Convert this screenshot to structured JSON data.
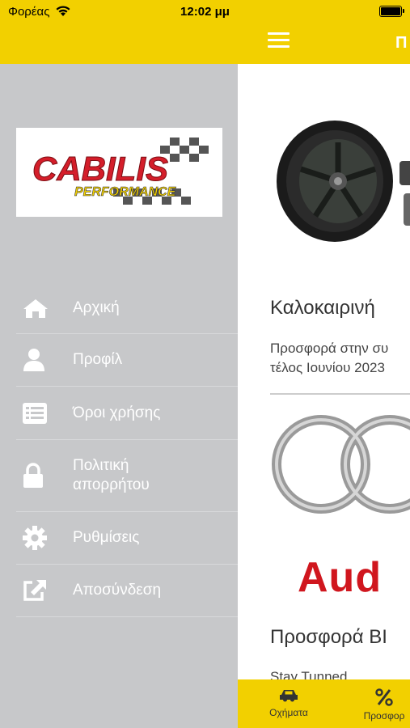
{
  "status_bar": {
    "carrier": "Φορέας",
    "time": "12:02 μμ"
  },
  "nav": {
    "title_partial": "Π"
  },
  "logo": {
    "brand": "CABILIS",
    "sub": "PERFORMANCE"
  },
  "menu": {
    "items": [
      {
        "label": "Αρχική",
        "icon": "home-icon"
      },
      {
        "label": "Προφίλ",
        "icon": "user-icon"
      },
      {
        "label": "Όροι χρήσης",
        "icon": "list-icon"
      },
      {
        "label": "Πολιτική απορρήτου",
        "icon": "lock-icon"
      },
      {
        "label": "Ρυθμίσεις",
        "icon": "gear-icon"
      },
      {
        "label": "Αποσύνδεση",
        "icon": "external-link-icon"
      }
    ]
  },
  "content": {
    "card1_title": "Καλοκαιρινή",
    "card1_text_line1": "Προσφορά στην συ",
    "card1_text_line2": "τέλος Ιουνίου 2023",
    "audi_logo_text": "Aud",
    "card2_title": "Προσφορά ΒΙ",
    "card2_text": "Stay Tunned"
  },
  "tabs": [
    {
      "label": "Οχήματα",
      "icon": "car-icon"
    },
    {
      "label": "Προσφορ",
      "icon": "percent-icon"
    }
  ],
  "colors": {
    "accent_yellow": "#f2d000",
    "drawer_gray": "#c7c8ca",
    "audi_red": "#d0161e"
  }
}
